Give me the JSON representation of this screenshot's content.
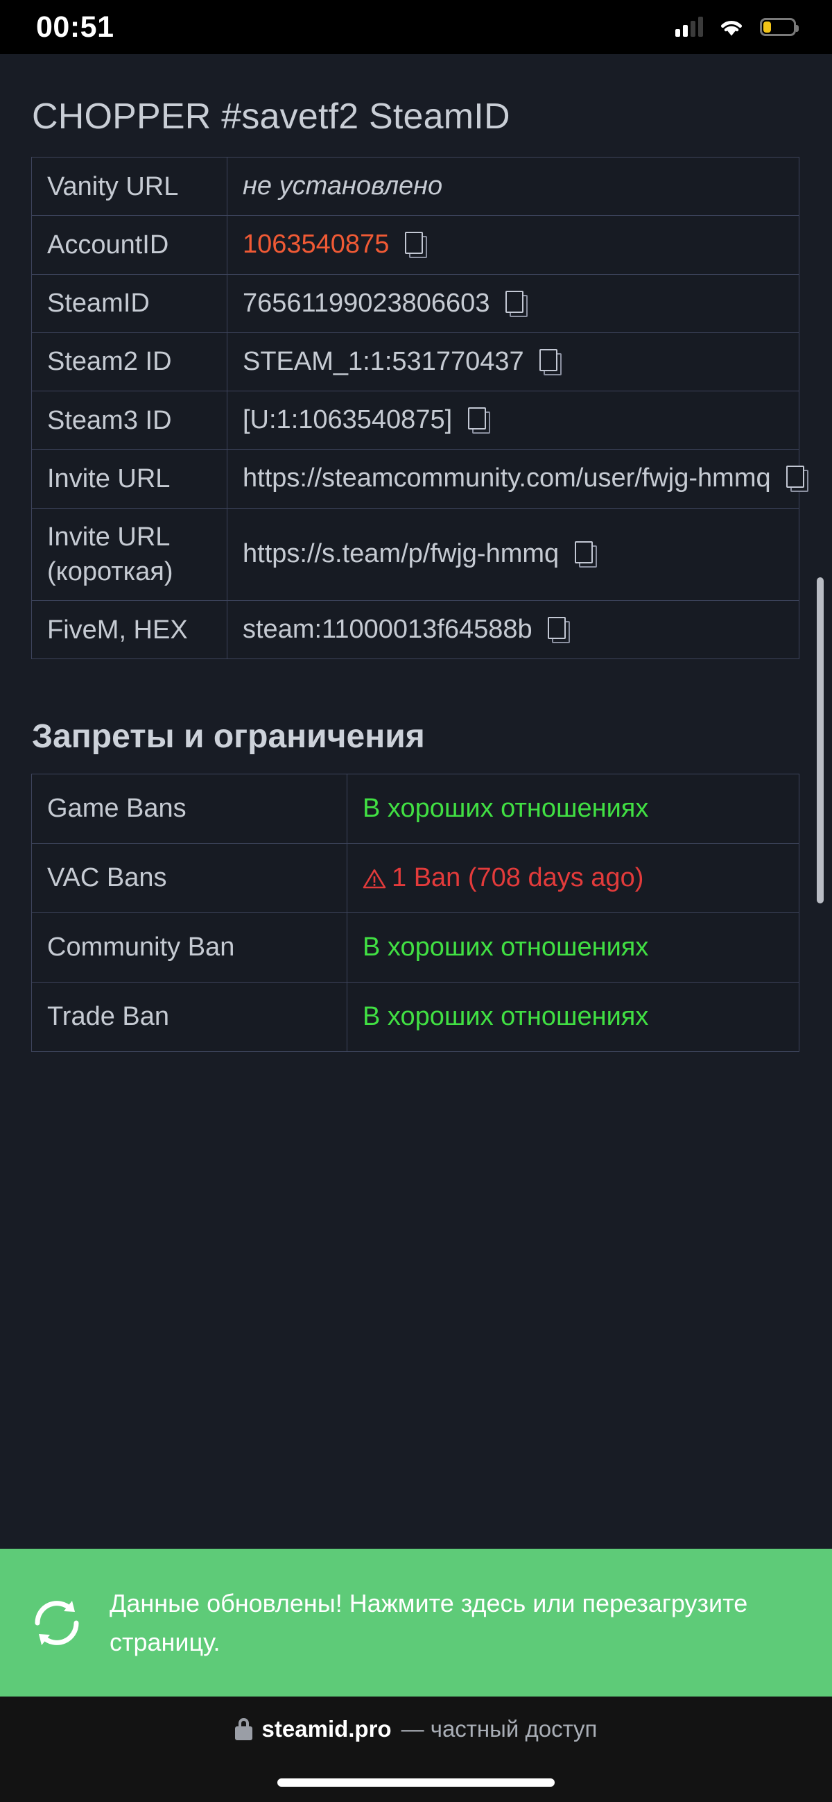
{
  "status_bar": {
    "time": "00:51",
    "signal_icon": "cellular-signal-icon",
    "wifi_icon": "wifi-icon",
    "battery_icon": "battery-low-power-icon"
  },
  "page": {
    "title": "CHOPPER #savetf2 SteamID",
    "section_bans_title": "Запреты и ограничения"
  },
  "steamid_table": {
    "rows": [
      {
        "key": "Vanity URL",
        "value": "не установлено",
        "style": "italic",
        "copy": false
      },
      {
        "key": "AccountID",
        "value": "1063540875",
        "style": "orange",
        "copy": true
      },
      {
        "key": "SteamID",
        "value": "76561199023806603",
        "style": "normal",
        "copy": true
      },
      {
        "key": "Steam2 ID",
        "value": "STEAM_1:1:531770437",
        "style": "normal",
        "copy": true
      },
      {
        "key": "Steam3 ID",
        "value": "[U:1:1063540875]",
        "style": "normal",
        "copy": true
      },
      {
        "key": "Invite URL",
        "value": "https://steamcommunity.com/user/fwjg-hmmq",
        "style": "normal",
        "copy": true
      },
      {
        "key": "Invite URL (короткая)",
        "value": "https://s.team/p/fwjg-hmmq",
        "style": "normal",
        "copy": true
      },
      {
        "key": "FiveM, HEX",
        "value": "steam:11000013f64588b",
        "style": "normal",
        "copy": true
      }
    ]
  },
  "bans_table": {
    "rows": [
      {
        "key": "Game Bans",
        "value": "В хороших отношениях",
        "style": "green",
        "warn": false
      },
      {
        "key": "VAC Bans",
        "value": "1 Ban (708 days ago)",
        "style": "red",
        "warn": true
      },
      {
        "key": "Community Ban",
        "value": "В хороших отношениях",
        "style": "green",
        "warn": false
      },
      {
        "key": "Trade Ban",
        "value": "В хороших отношениях",
        "style": "green",
        "warn": false
      }
    ]
  },
  "toast": {
    "icon": "refresh-icon",
    "message": "Данные обновлены! Нажмите здесь или перезагрузите страницу.",
    "background": "#5ecb78"
  },
  "bottom_bar": {
    "lock_icon": "lock-icon",
    "domain": "steamid.pro",
    "note": "— частный доступ"
  },
  "colors": {
    "page_bg": "#181c25",
    "accent_orange": "#f05a35",
    "status_green": "#41e043",
    "status_red": "#e33b3b",
    "toast_green": "#5ecb78"
  }
}
